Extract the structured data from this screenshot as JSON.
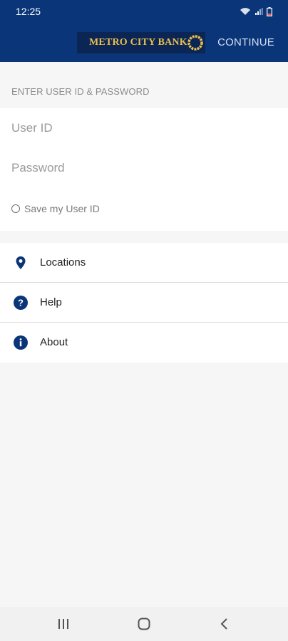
{
  "status_bar": {
    "time": "12:25"
  },
  "app_bar": {
    "logo_text": "METRO CITY BANK",
    "continue_label": "CONTINUE"
  },
  "login": {
    "section_label": "ENTER USER ID & PASSWORD",
    "user_id_placeholder": "User ID",
    "password_placeholder": "Password",
    "save_user_id_label": "Save my User ID"
  },
  "menu": {
    "items": [
      {
        "label": "Locations",
        "icon": "location-pin-icon"
      },
      {
        "label": "Help",
        "icon": "help-circle-icon"
      },
      {
        "label": "About",
        "icon": "info-circle-icon"
      }
    ]
  },
  "colors": {
    "brand_blue": "#0a3679",
    "logo_bg": "#0b2554",
    "logo_gold": "#e9c04e",
    "page_bg": "#f6f6f6"
  }
}
